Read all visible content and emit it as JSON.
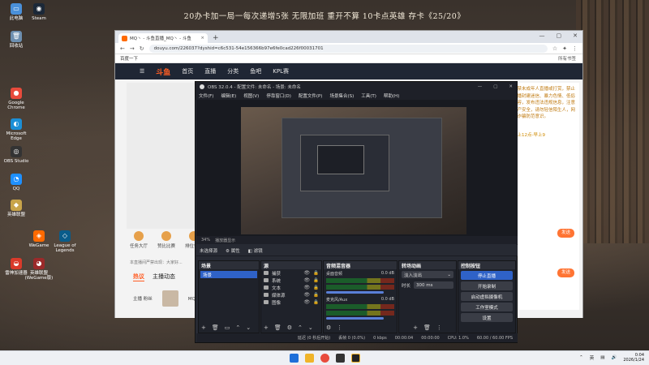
{
  "banner": "20办卡加一局一每次递增5张  无限加班  重开不算  10卡点英雄  存卡《25/20》",
  "desktop_icons": [
    {
      "label": "此电脑",
      "color": "#4a90d9",
      "glyph": "▭"
    },
    {
      "label": "Steam",
      "color": "#1b2838",
      "glyph": "◉"
    },
    {
      "label": "回收站",
      "color": "#6d8fb0",
      "glyph": "🗑"
    },
    {
      "label": "Google Chrome",
      "color": "#e84b3c",
      "glyph": "●"
    },
    {
      "label": "Microsoft Edge",
      "color": "#1c8fd6",
      "glyph": "◐"
    },
    {
      "label": "OBS Studio",
      "color": "#333333",
      "glyph": "◎"
    },
    {
      "label": "QQ",
      "color": "#1e90ff",
      "glyph": "◔"
    },
    {
      "label": "英雄联盟",
      "color": "#c8a44a",
      "glyph": "◆"
    },
    {
      "label": "WeGame",
      "color": "#ff6a00",
      "glyph": "◈"
    },
    {
      "label": "League of Legends",
      "color": "#0a5c8a",
      "glyph": "◇"
    },
    {
      "label": "雷神加速器",
      "color": "#d93a2a",
      "glyph": "◒"
    },
    {
      "label": "英雄联盟(WeGame版)",
      "color": "#9b2a2a",
      "glyph": "◕"
    }
  ],
  "browser": {
    "tab_title": "MQ丶 - 斗鱼直播_MQ丶 - 斗鱼",
    "new_tab": "+",
    "url": "douyu.com/226037?dyshid=c6c531-54e156366b97e6fe0cad226f00031701",
    "bookmark": "百度一下",
    "all_bookmarks": "所有书签",
    "douyu": {
      "logo": "斗鱼",
      "nav": [
        "首页",
        "直播",
        "分类",
        "鱼吧",
        "KPL赛"
      ],
      "tools": [
        {
          "label": "任务大厅"
        },
        {
          "label": "赞比比赛"
        },
        {
          "label": "排位领奖"
        }
      ],
      "announce": "本直播间严禁出现：大家好...",
      "tabs": [
        {
          "label": "热议",
          "active": true
        },
        {
          "label": "主播动态",
          "active": false
        }
      ],
      "info": [
        {
          "label": "主播\n粉丝"
        },
        {
          "label": "MQ丶 主播动态"
        }
      ],
      "sidebar_notice": "严禁未成年人直播或打赏，禁止传播封建迷信、暴力色情、低俗内容，发布违法违规信息，注意财产安全，请勿轻信陌生人，网络诈骗防范意识。",
      "sidebar_time": "晚上12点-早上9",
      "send_label": "发送",
      "send_label_2": "发送"
    }
  },
  "obs": {
    "title": "OBS 32.0.4 - 配置文件: 未命名 - 场景: 未命名",
    "menu": [
      "文件(F)",
      "编辑(E)",
      "视图(V)",
      "停靠窗口(D)",
      "配置文件(P)",
      "场景集合(S)",
      "工具(T)",
      "帮助(H)"
    ],
    "zoom": "34%",
    "zoom_label": "播放器显示",
    "no_source": "未选择源",
    "properties": "属性",
    "filters": "滤镜",
    "docks": {
      "scenes": {
        "title": "场景",
        "items": [
          "场景"
        ]
      },
      "sources": {
        "title": "源",
        "items": [
          "捕获",
          "系统",
          "文本",
          "媒体源",
          "图像"
        ]
      },
      "mixer": {
        "title": "音频混音器",
        "channels": [
          {
            "name": "桌面音频",
            "db": "0.0 dB"
          },
          {
            "name": "麦克风/Aux",
            "db": "0.0 dB"
          }
        ]
      },
      "transitions": {
        "title": "转场动画",
        "type": "淡入淡出",
        "duration_label": "时长",
        "duration": "300 ms"
      },
      "controls": {
        "title": "控制按钮",
        "buttons": [
          "停止直播",
          "开始录制",
          "启动虚拟摄像机",
          "工作室模式",
          "设置"
        ]
      }
    },
    "status": {
      "stream": "延迟 (0 秒后开始)",
      "dropped": "丢帧 0 (0.0%)",
      "bitrate": "0 kbps",
      "live": "00:00:04",
      "rec": "00:00:00",
      "cpu": "CPU: 1.0%",
      "fps": "60.00 / 60.00 FPS"
    }
  },
  "taskbar": {
    "lang": "英",
    "time": "0:04",
    "date": "2026/1/24"
  }
}
